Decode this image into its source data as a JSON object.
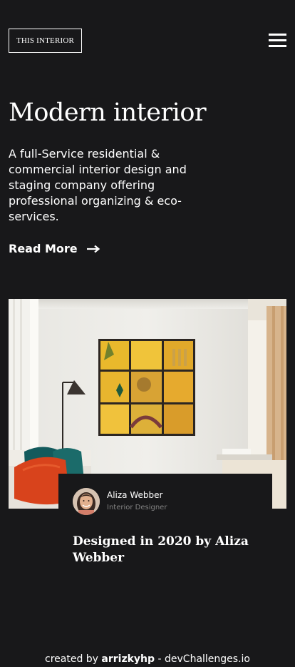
{
  "header": {
    "logo_text": "THIS INTERIOR",
    "menu_icon": "hamburger-menu-icon"
  },
  "hero": {
    "title": "Modern interior",
    "description": "A full-Service residential & commercial interior design and staging company offering professional organizing & eco-services.",
    "read_more_label": "Read More",
    "read_more_icon": "arrow-right-icon"
  },
  "feature": {
    "image": "living-room-photo",
    "author": {
      "name": "Aliza Webber",
      "role": "Interior Designer",
      "avatar": "avatar-photo"
    },
    "caption": "Designed in 2020 by Aliza Webber"
  },
  "footer": {
    "prefix": "created by",
    "author": "arrizkyhp",
    "separator": "-",
    "site": "devChallenges.io"
  },
  "colors": {
    "background": "#18181a",
    "text": "#ffffff",
    "muted": "#828282"
  }
}
